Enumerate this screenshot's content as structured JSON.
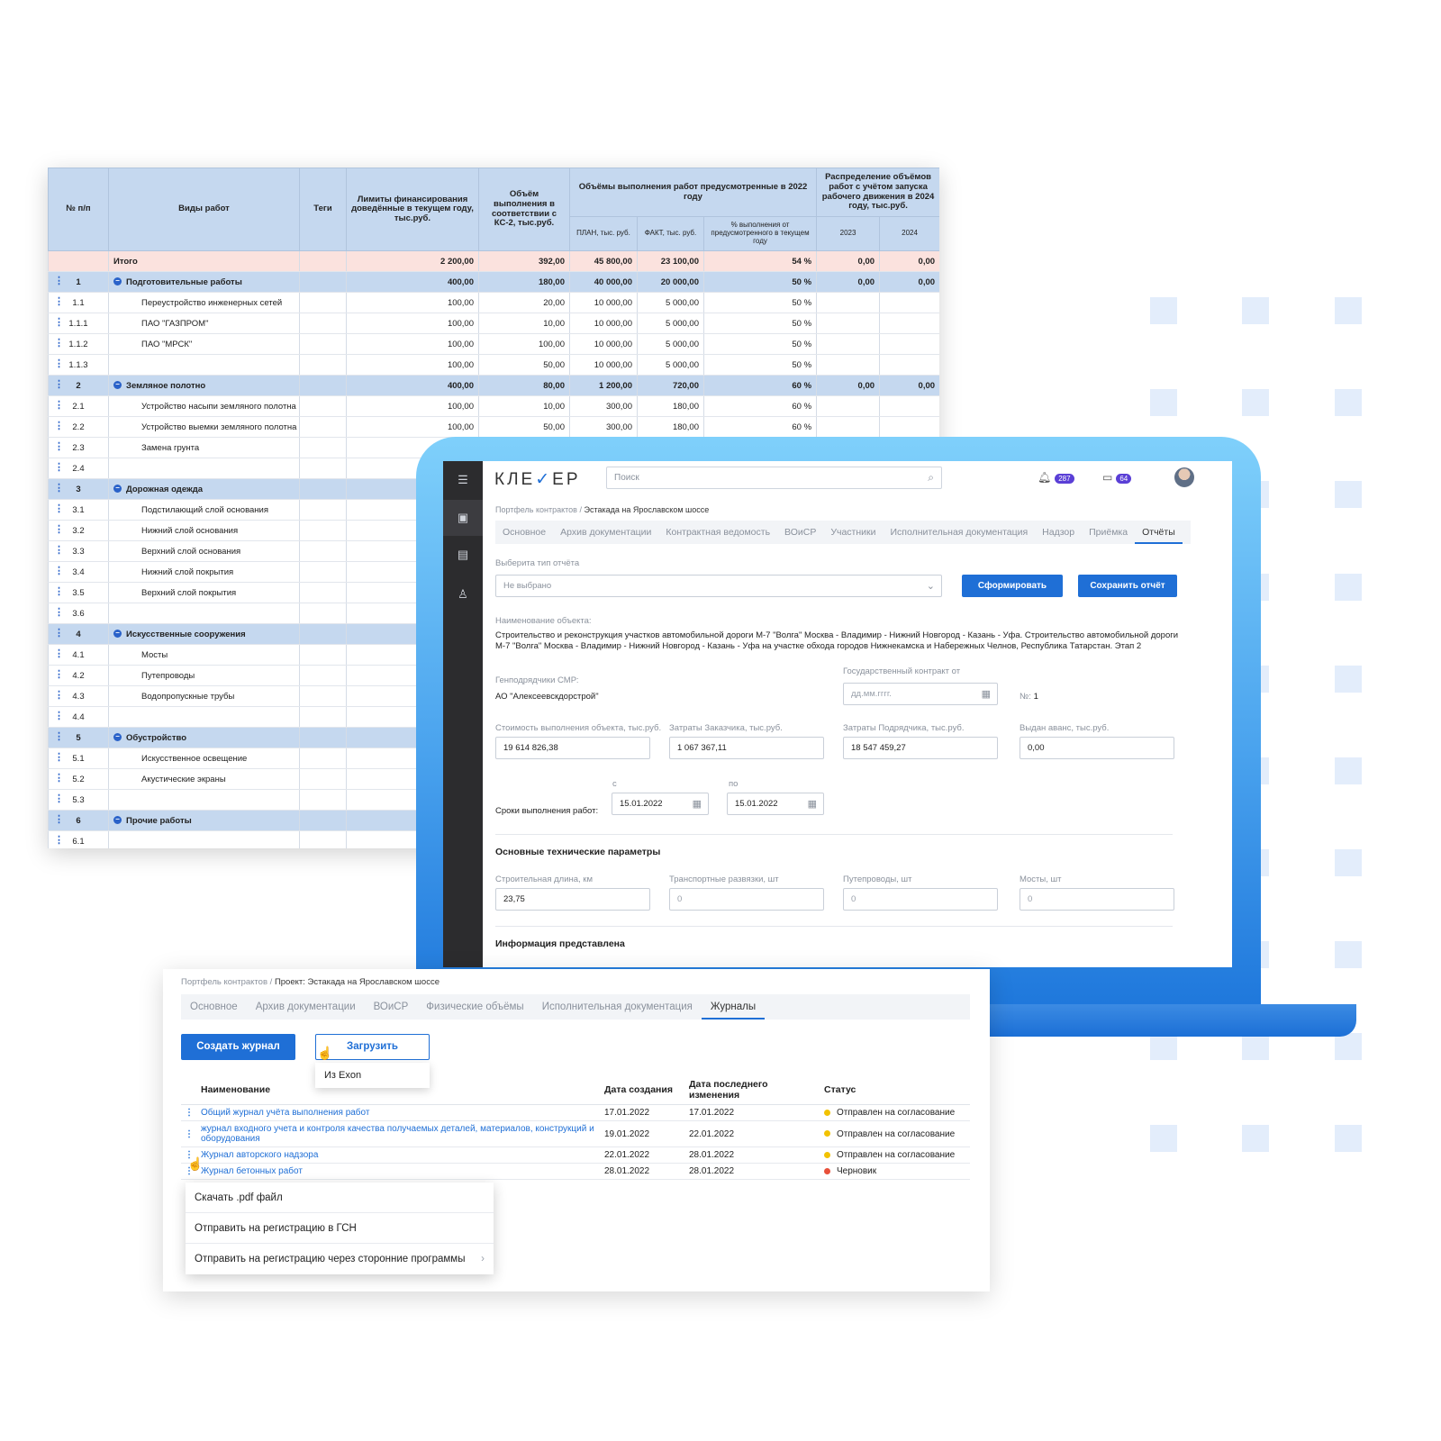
{
  "colors": {
    "accent": "#1f6fd6",
    "status_yellow": "#f2c200",
    "status_red": "#e8503a",
    "laptop_blue": "#4aa3ee"
  },
  "sheet": {
    "headers": {
      "num": "№ п/п",
      "work": "Виды работ",
      "tags": "Теги",
      "limits": "Лимиты финансирования доведённые в текущем году, тыс.руб.",
      "ks2": "Объём выполнения в соответствии с КС-2, тыс.руб.",
      "volumes": "Объёмы выполнения работ предусмотренные в 2022 году",
      "plan": "ПЛАН, тыс. руб.",
      "fact": "ФАКТ, тыс. руб.",
      "pct": "% выполнения от предусмотренного в текущем году",
      "distribution": "Распределение объёмов работ с учётом запуска рабочего движения в 2024 году, тыс.руб.",
      "y2023": "2023",
      "y2024": "2024"
    },
    "rows": [
      {
        "idx": "",
        "name": "Итого",
        "type": "total",
        "limit": "2 200,00",
        "ks2": "392,00",
        "plan": "45 800,00",
        "fact": "23 100,00",
        "pct": "54 %",
        "y2023": "0,00",
        "y2024": "0,00"
      },
      {
        "idx": "1",
        "name": "Подготовительные работы",
        "type": "group",
        "limit": "400,00",
        "ks2": "180,00",
        "plan": "40 000,00",
        "fact": "20 000,00",
        "pct": "50 %",
        "y2023": "0,00",
        "y2024": "0,00"
      },
      {
        "idx": "1.1",
        "name": "Переустройство инженерных сетей",
        "type": "item",
        "limit": "100,00",
        "ks2": "20,00",
        "plan": "10 000,00",
        "fact": "5 000,00",
        "pct": "50 %",
        "y2023": "",
        "y2024": ""
      },
      {
        "idx": "1.1.1",
        "name": "ПАО \"ГАЗПРОМ\"",
        "type": "item",
        "limit": "100,00",
        "ks2": "10,00",
        "plan": "10 000,00",
        "fact": "5 000,00",
        "pct": "50 %",
        "y2023": "",
        "y2024": ""
      },
      {
        "idx": "1.1.2",
        "name": "ПАО \"МРСК\"",
        "type": "item",
        "limit": "100,00",
        "ks2": "100,00",
        "plan": "10 000,00",
        "fact": "5 000,00",
        "pct": "50 %",
        "y2023": "",
        "y2024": ""
      },
      {
        "idx": "1.1.3",
        "name": "",
        "type": "item",
        "limit": "100,00",
        "ks2": "50,00",
        "plan": "10 000,00",
        "fact": "5 000,00",
        "pct": "50 %",
        "y2023": "",
        "y2024": ""
      },
      {
        "idx": "2",
        "name": "Земляное полотно",
        "type": "group",
        "limit": "400,00",
        "ks2": "80,00",
        "plan": "1 200,00",
        "fact": "720,00",
        "pct": "60 %",
        "y2023": "0,00",
        "y2024": "0,00"
      },
      {
        "idx": "2.1",
        "name": "Устройство насыпи земляного полотна",
        "type": "item",
        "limit": "100,00",
        "ks2": "10,00",
        "plan": "300,00",
        "fact": "180,00",
        "pct": "60 %",
        "y2023": "",
        "y2024": ""
      },
      {
        "idx": "2.2",
        "name": "Устройство выемки земляного полотна",
        "type": "item",
        "limit": "100,00",
        "ks2": "50,00",
        "plan": "300,00",
        "fact": "180,00",
        "pct": "60 %",
        "y2023": "",
        "y2024": ""
      },
      {
        "idx": "2.3",
        "name": "Замена грунта",
        "type": "item",
        "limit": "",
        "ks2": "",
        "plan": "",
        "fact": "",
        "pct": "",
        "y2023": "",
        "y2024": ""
      },
      {
        "idx": "2.4",
        "name": "",
        "type": "item",
        "limit": "",
        "ks2": "",
        "plan": "",
        "fact": "",
        "pct": "",
        "y2023": "",
        "y2024": ""
      },
      {
        "idx": "3",
        "name": "Дорожная одежда",
        "type": "group",
        "limit": "",
        "ks2": "",
        "plan": "",
        "fact": "",
        "pct": "",
        "y2023": "",
        "y2024": ""
      },
      {
        "idx": "3.1",
        "name": "Подстилающий слой основания",
        "type": "item",
        "limit": "",
        "ks2": "",
        "plan": "",
        "fact": "",
        "pct": "",
        "y2023": "",
        "y2024": ""
      },
      {
        "idx": "3.2",
        "name": "Нижний слой основания",
        "type": "item",
        "limit": "",
        "ks2": "",
        "plan": "",
        "fact": "",
        "pct": "",
        "y2023": "",
        "y2024": ""
      },
      {
        "idx": "3.3",
        "name": "Верхний слой основания",
        "type": "item",
        "limit": "",
        "ks2": "",
        "plan": "",
        "fact": "",
        "pct": "",
        "y2023": "",
        "y2024": ""
      },
      {
        "idx": "3.4",
        "name": "Нижний слой покрытия",
        "type": "item",
        "limit": "",
        "ks2": "",
        "plan": "",
        "fact": "",
        "pct": "",
        "y2023": "",
        "y2024": ""
      },
      {
        "idx": "3.5",
        "name": "Верхний слой покрытия",
        "type": "item",
        "limit": "",
        "ks2": "",
        "plan": "",
        "fact": "",
        "pct": "",
        "y2023": "",
        "y2024": ""
      },
      {
        "idx": "3.6",
        "name": "",
        "type": "item",
        "limit": "",
        "ks2": "",
        "plan": "",
        "fact": "",
        "pct": "",
        "y2023": "",
        "y2024": ""
      },
      {
        "idx": "4",
        "name": "Искусственные сооружения",
        "type": "group",
        "limit": "",
        "ks2": "",
        "plan": "",
        "fact": "",
        "pct": "",
        "y2023": "",
        "y2024": ""
      },
      {
        "idx": "4.1",
        "name": "Мосты",
        "type": "item",
        "limit": "",
        "ks2": "",
        "plan": "",
        "fact": "",
        "pct": "",
        "y2023": "",
        "y2024": ""
      },
      {
        "idx": "4.2",
        "name": "Путепроводы",
        "type": "item",
        "limit": "",
        "ks2": "",
        "plan": "",
        "fact": "",
        "pct": "",
        "y2023": "",
        "y2024": ""
      },
      {
        "idx": "4.3",
        "name": "Водопропускные трубы",
        "type": "item",
        "limit": "",
        "ks2": "",
        "plan": "",
        "fact": "",
        "pct": "",
        "y2023": "",
        "y2024": ""
      },
      {
        "idx": "4.4",
        "name": "",
        "type": "item",
        "limit": "",
        "ks2": "",
        "plan": "",
        "fact": "",
        "pct": "",
        "y2023": "",
        "y2024": ""
      },
      {
        "idx": "5",
        "name": "Обустройство",
        "type": "group",
        "limit": "",
        "ks2": "",
        "plan": "",
        "fact": "",
        "pct": "",
        "y2023": "",
        "y2024": ""
      },
      {
        "idx": "5.1",
        "name": "Искусственное освещение",
        "type": "item",
        "limit": "",
        "ks2": "",
        "plan": "",
        "fact": "",
        "pct": "",
        "y2023": "",
        "y2024": ""
      },
      {
        "idx": "5.2",
        "name": "Акустические экраны",
        "type": "item",
        "limit": "",
        "ks2": "",
        "plan": "",
        "fact": "",
        "pct": "",
        "y2023": "",
        "y2024": ""
      },
      {
        "idx": "5.3",
        "name": "",
        "type": "item",
        "limit": "",
        "ks2": "",
        "plan": "",
        "fact": "",
        "pct": "",
        "y2023": "",
        "y2024": ""
      },
      {
        "idx": "6",
        "name": "Прочие работы",
        "type": "group",
        "limit": "",
        "ks2": "",
        "plan": "",
        "fact": "",
        "pct": "",
        "y2023": "",
        "y2024": ""
      },
      {
        "idx": "6.1",
        "name": "",
        "type": "item",
        "limit": "",
        "ks2": "",
        "plan": "",
        "fact": "",
        "pct": "",
        "y2023": "",
        "y2024": ""
      }
    ]
  },
  "laptop": {
    "logo": {
      "left": "КЛЕ",
      "check": "✓",
      "right": "ЕР"
    },
    "search": {
      "placeholder": "Поиск"
    },
    "notifications_count": "287",
    "messages_count": "64",
    "breadcrumb": {
      "root": "Портфель контрактов",
      "sep": " / ",
      "current": "Эстакада на Ярославском шоссе"
    },
    "tabs": [
      "Основное",
      "Архив документации",
      "Контрактная ведомость",
      "ВОиСР",
      "Участники",
      "Исполнительная документация",
      "Надзор",
      "Приёмка",
      "Отчёты"
    ],
    "report_type_label": "Выберита тип отчёта",
    "report_type_value": "Не выбрано",
    "btn_generate": "Сформировать",
    "btn_save": "Сохранить отчёт",
    "object_name_label": "Наименование объекта:",
    "object_name": "Строительство и реконструкция участков автомобильной дороги М-7 \"Волга\" Москва - Владимир - Нижний Новгород - Казань - Уфа. Строительство автомобильной дороги М-7 \"Волга\" Москва - Владимир - Нижний Новгород - Казань - Уфа на участке обхода городов Нижнекамска и Набережных Челнов, Республика Татарстан. Этап 2",
    "contractor_label": "Генподрядчики СМР:",
    "contractor": "АО \"Алексеевскдорстрой\"",
    "contract_label": "Государственный контракт от",
    "contract_date_placeholder": "дд.мм.гггг.",
    "contract_no_label": "№:",
    "contract_no": "1",
    "cost_label": "Стоимость выполнения объекта, тыс.руб.",
    "cost": "19 614 826,38",
    "customer_cost_label": "Затраты Заказчика, тыс.руб.",
    "customer_cost": "1 067 367,11",
    "contractor_cost_label": "Затраты Подрядчика, тыс.руб.",
    "contractor_cost": "18 547 459,27",
    "advance_label": "Выдан аванс, тыс.руб.",
    "advance": "0,00",
    "from_label": "с",
    "to_label": "по",
    "terms_label": "Сроки выполнения работ:",
    "date_from": "15.01.2022",
    "date_to": "15.01.2022",
    "tech_title": "Основные технические параметры",
    "length_label": "Строительная длина, км",
    "length": "23,75",
    "junctions_label": "Транспортные развязки, шт",
    "junctions": "0",
    "overpasses_label": "Путепроводы, шт",
    "overpasses": "0",
    "bridges_label": "Мосты, шт",
    "bridges": "0",
    "info_title": "Информация представлена"
  },
  "journals": {
    "breadcrumb": {
      "root": "Портфель контрактов",
      "sep": " / ",
      "current": "Проект: Эстакада на Ярославском шоссе"
    },
    "tabs": [
      "Основное",
      "Архив документации",
      "ВОиСР",
      "Физические объёмы",
      "Исполнительная документация",
      "Журналы"
    ],
    "btn_create": "Создать журнал",
    "btn_upload": "Загрузить",
    "upload_option": "Из Exon",
    "columns": [
      "Наименование",
      "Дата создания",
      "Дата последнего изменения",
      "Статус"
    ],
    "rows": [
      {
        "name": "Общий журнал учёта выполнения работ",
        "created": "17.01.2022",
        "modified": "17.01.2022",
        "status": "Отправлен на согласование",
        "color": "#f2c200"
      },
      {
        "name": "журнал входного учета и контроля качества получаемых деталей, материалов, конструкций и оборудования",
        "created": "19.01.2022",
        "modified": "22.01.2022",
        "status": "Отправлен на согласование",
        "color": "#f2c200"
      },
      {
        "name": "Журнал авторского надзора",
        "created": "22.01.2022",
        "modified": "28.01.2022",
        "status": "Отправлен на согласование",
        "color": "#f2c200"
      },
      {
        "name": "Журнал бетонных работ",
        "created": "28.01.2022",
        "modified": "28.01.2022",
        "status": "Черновик",
        "color": "#e8503a"
      }
    ],
    "context_menu": [
      "Скачать .pdf файл",
      "Отправить на регистрацию в ГСН",
      "Отправить на регистрацию через сторонние программы"
    ]
  }
}
